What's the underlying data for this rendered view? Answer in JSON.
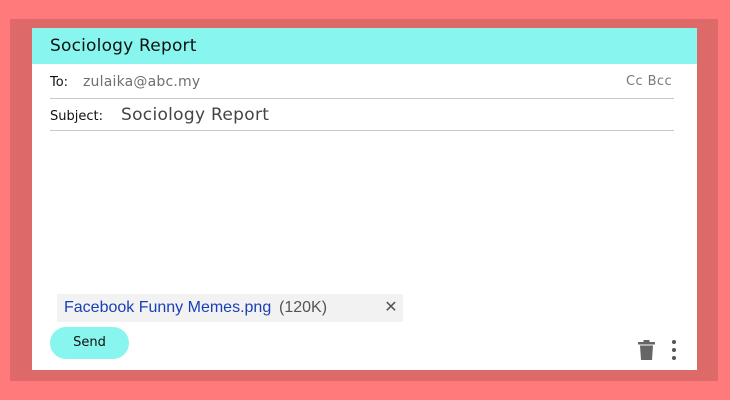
{
  "window": {
    "title": "Sociology Report"
  },
  "compose": {
    "to_label": "To:",
    "to_value": "zulaika@abc.my",
    "cc_bcc_label": "Cc Bcc",
    "subject_label": "Subject:",
    "subject_value": "Sociology Report",
    "body_value": ""
  },
  "attachment": {
    "name": "Facebook Funny Memes.png",
    "size": "(120K)",
    "remove_icon": "close-icon"
  },
  "actions": {
    "send_label": "Send",
    "delete_icon": "trash-icon",
    "more_icon": "more-vertical-icon"
  },
  "colors": {
    "background": "#ff7a7a",
    "frame": "#dd6969",
    "accent": "#88f6ee",
    "link": "#1a3fb5"
  }
}
